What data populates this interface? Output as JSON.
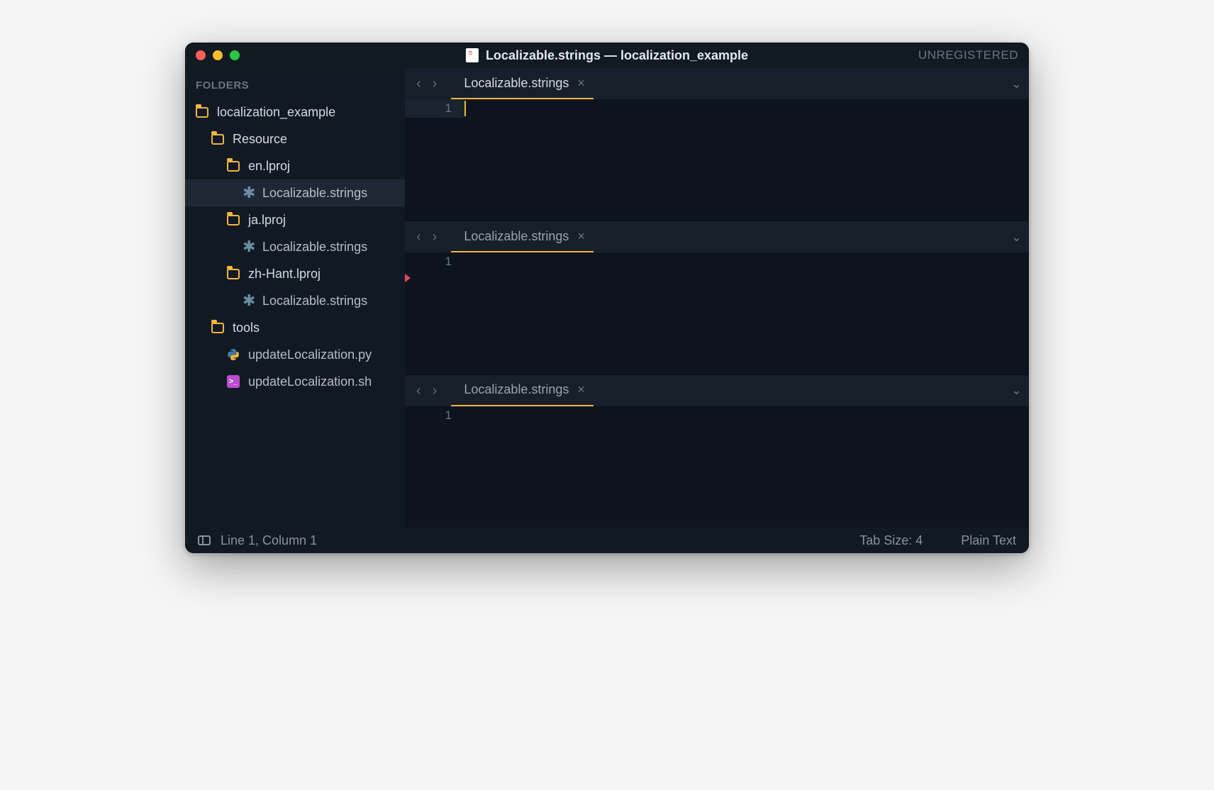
{
  "window": {
    "title": "Localizable.strings — localization_example",
    "registration": "UNREGISTERED"
  },
  "sidebar": {
    "header": "FOLDERS",
    "tree": [
      {
        "label": "localization_example",
        "type": "folder",
        "indent": 0
      },
      {
        "label": "Resource",
        "type": "folder",
        "indent": 1
      },
      {
        "label": "en.lproj",
        "type": "folder",
        "indent": 2
      },
      {
        "label": "Localizable.strings",
        "type": "file-strings",
        "indent": 3,
        "active": true
      },
      {
        "label": "ja.lproj",
        "type": "folder",
        "indent": 2
      },
      {
        "label": "Localizable.strings",
        "type": "file-strings",
        "indent": 3
      },
      {
        "label": "zh-Hant.lproj",
        "type": "folder",
        "indent": 2
      },
      {
        "label": "Localizable.strings",
        "type": "file-strings",
        "indent": 3
      },
      {
        "label": "tools",
        "type": "folder",
        "indent": 1
      },
      {
        "label": "updateLocalization.py",
        "type": "file-py",
        "indent": 2
      },
      {
        "label": "updateLocalization.sh",
        "type": "file-sh",
        "indent": 2
      }
    ]
  },
  "editors": [
    {
      "tab_name": "Localizable.strings",
      "line": "1",
      "focused": true
    },
    {
      "tab_name": "Localizable.strings",
      "line": "1",
      "focused": false,
      "has_marker": true
    },
    {
      "tab_name": "Localizable.strings",
      "line": "1",
      "focused": false
    }
  ],
  "statusbar": {
    "position": "Line 1, Column 1",
    "tab_size": "Tab Size: 4",
    "syntax": "Plain Text"
  }
}
